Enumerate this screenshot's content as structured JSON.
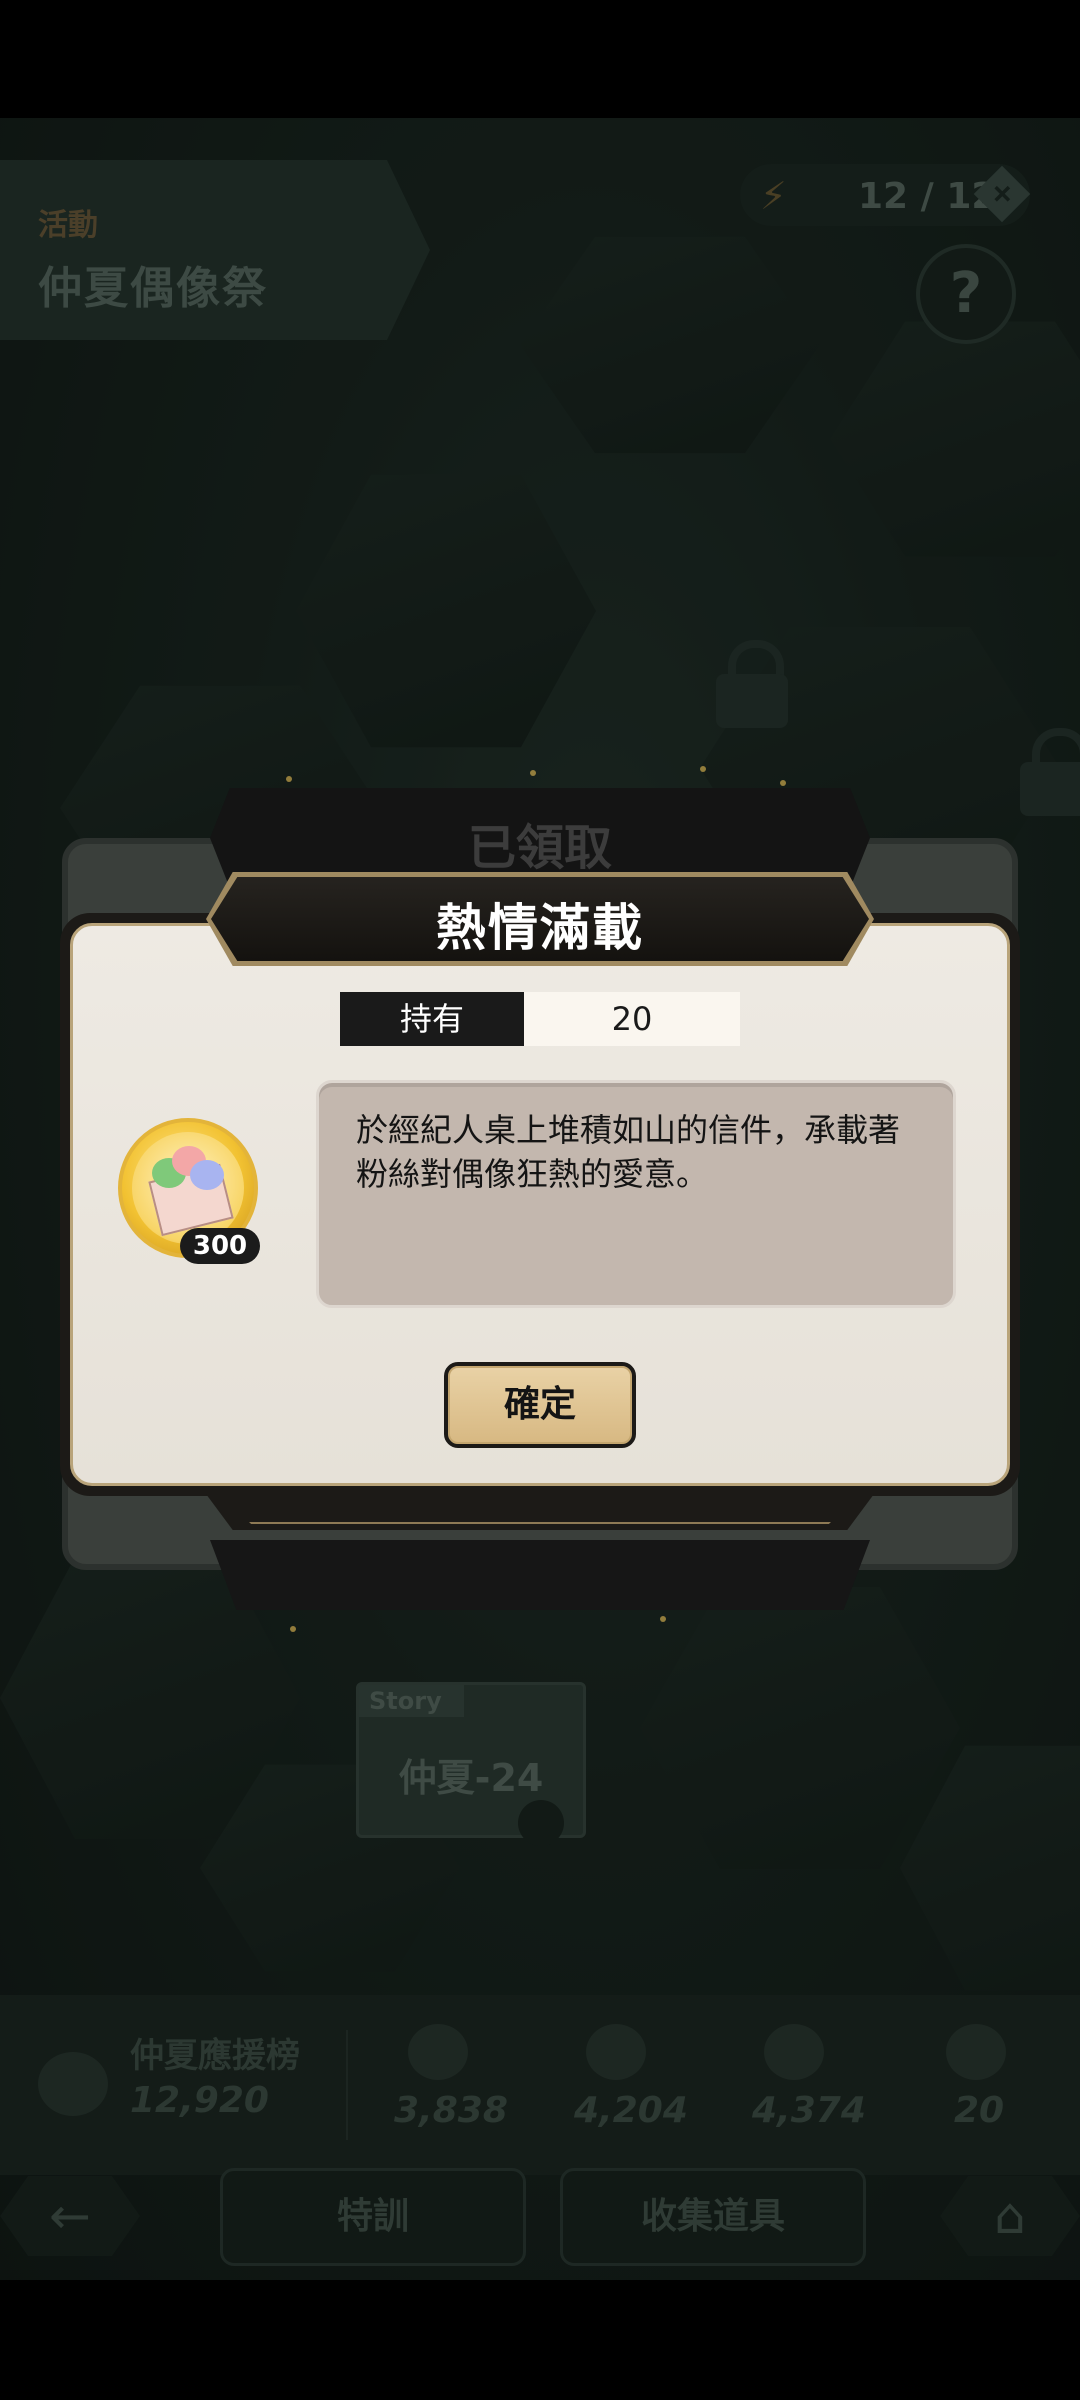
{
  "background": {
    "stage_small_label": "活動",
    "stage_name": "仲夏偶像祭",
    "energy": "12 / 120",
    "help_icon": "?",
    "story_node": {
      "tag": "Story",
      "label": "仲夏-24"
    },
    "stats": {
      "ranking_label": "仲夏應援榜",
      "ranking_value": "12,920",
      "values": [
        "3,838",
        "4,204",
        "4,374",
        "20"
      ]
    },
    "nav": {
      "special_label": "特訓",
      "collect_label": "收集道具"
    }
  },
  "back_dialog": {
    "title": "已領取"
  },
  "item_dialog": {
    "title": "熱情滿載",
    "owned_label": "持有",
    "owned_value": "20",
    "item_icon": "fan-letter-icon",
    "item_badge": "300",
    "description": "於經紀人桌上堆積如山的信件，承載著粉絲對偶像狂熱的愛意。",
    "confirm_label": "確定"
  },
  "colors": {
    "dialog_bg": "#eeeae3",
    "title_bar": "#14120f",
    "gold_trim": "#b9a47a",
    "confirm_bg": "#e2c897",
    "desc_bg": "#c3b7ae"
  }
}
